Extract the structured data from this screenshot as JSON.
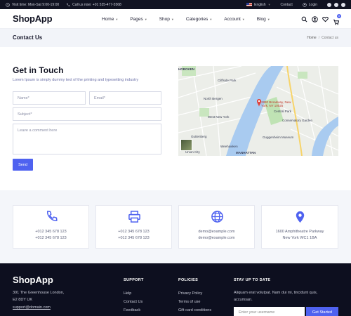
{
  "topbar": {
    "hours": "Visit time: Mon-Sat 9:00-19:00",
    "phone": "Call us now: +01 535-477-5568",
    "language": "English",
    "contact": "Contact",
    "login": "Login"
  },
  "header": {
    "logo": "ShopApp",
    "nav": [
      "Home",
      "Pages",
      "Shop",
      "Categories",
      "Account",
      "Blog"
    ],
    "cart_count": "0"
  },
  "titlebar": {
    "title": "Contact Us",
    "breadcrumb_home": "Home",
    "breadcrumb_current": "Contact us"
  },
  "contact": {
    "title": "Get in Touch",
    "subtitle": "Lorem Ipsum is simply dummy text of the printing and typesetting industry",
    "name_placeholder": "Name*",
    "email_placeholder": "Email*",
    "subject_placeholder": "Subject*",
    "comment_placeholder": "Leave a comment here",
    "send_label": "Send"
  },
  "map": {
    "pin_label_line1": "2880 Broadway, New",
    "pin_label_line2": "York, NY 10025",
    "labels": {
      "hoboken": "HOBOKEN",
      "manhattan": "MANHATTAN",
      "union_city": "Union City",
      "cliffside": "Cliffside Park",
      "guttenberg": "Guttenberg",
      "central_park": "Central Park",
      "cons_garden": "Conservatory Garden",
      "guggenheim": "Guggenheim Museum",
      "weehawken": "Weehawken",
      "west_new_york": "West New York",
      "north_bergen": "North Bergen"
    }
  },
  "cards": [
    {
      "icon": "phone-icon",
      "line1": "+012 345 678 123",
      "line2": "+012 345 678 123"
    },
    {
      "icon": "printer-icon",
      "line1": "+012 345 678 123",
      "line2": "+012 345 678 123"
    },
    {
      "icon": "globe-icon",
      "line1": "demo@example.com",
      "line2": "demo@example.com"
    },
    {
      "icon": "location-pin-icon",
      "line1": "1600 Amphitheatre Parkway",
      "line2": "New York WC1 1BA"
    }
  ],
  "footer": {
    "logo": "ShopApp",
    "address_line1": "301 The Greenhouse London,",
    "address_line2": "E2 8DY UK",
    "email": "support@domain.com",
    "support_head": "SUPPORT",
    "support_links": [
      "Help",
      "Contact Us",
      "Feedback"
    ],
    "policies_head": "POLICIES",
    "policies_links": [
      "Privacy Policy",
      "Terms of use",
      "Gift card conditions"
    ],
    "stay_head": "STAY UP TO DATE",
    "stay_text_line1": "Aliquam erat volutpat. Nam dui mi, tincidunt quis,",
    "stay_text_line2": "accumsan.",
    "subscribe_placeholder": "Enter your username",
    "subscribe_label": "Get Started"
  },
  "colors": {
    "accent": "#4f62f0",
    "dark": "#111322",
    "footer": "#0d0f1f"
  }
}
